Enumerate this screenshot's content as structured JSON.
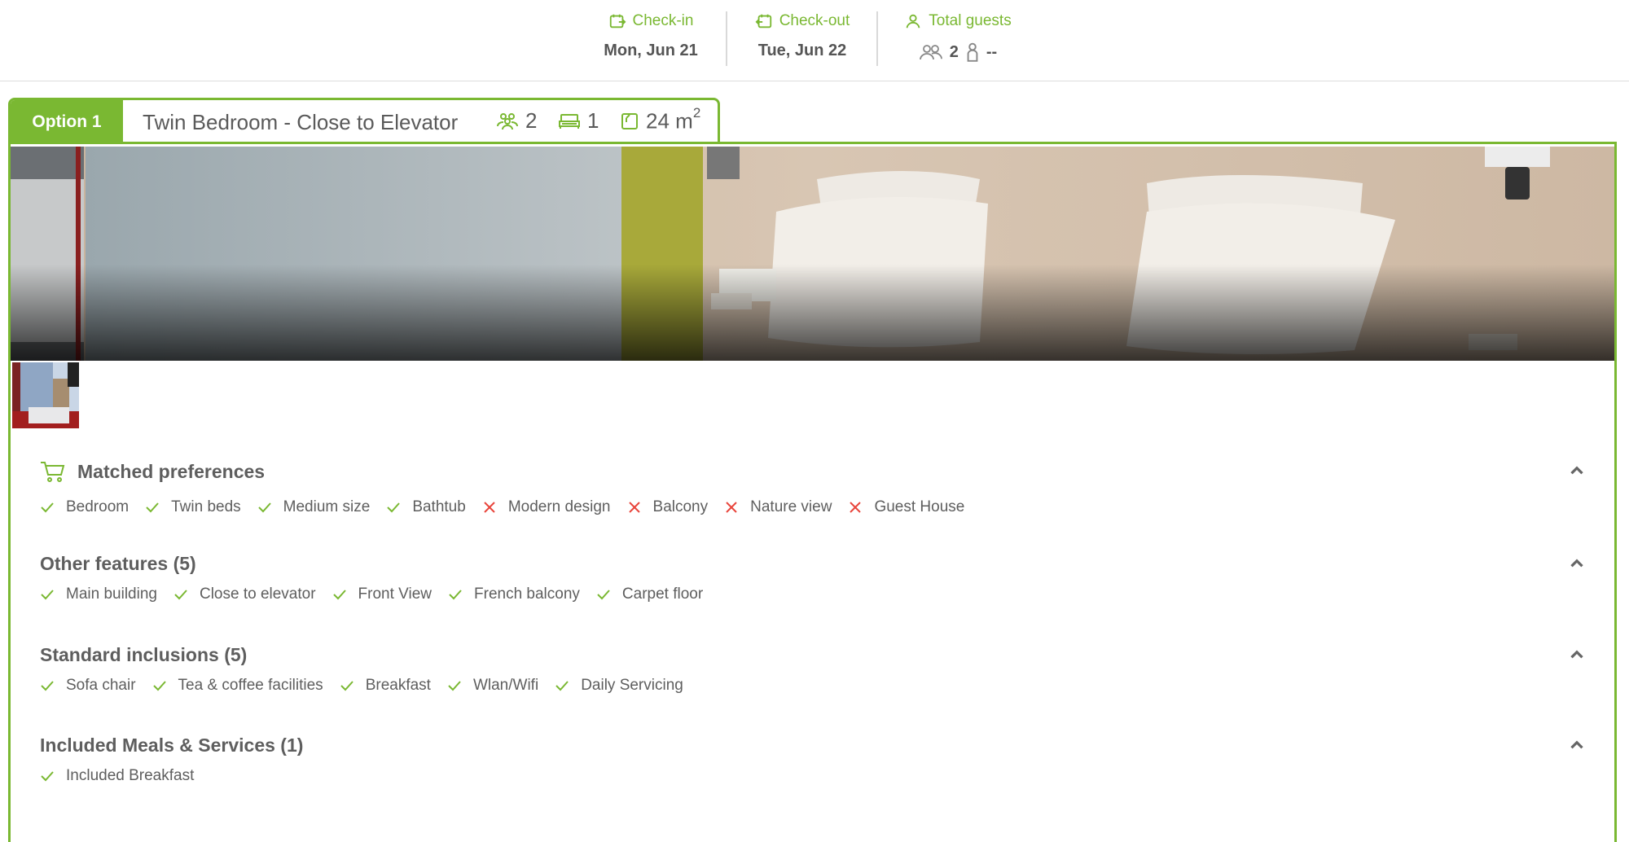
{
  "header": {
    "checkin_label": "Check-in",
    "checkin_value": "Mon, Jun 21",
    "checkout_label": "Check-out",
    "checkout_value": "Tue, Jun 22",
    "guests_label": "Total guests",
    "adults": "2",
    "children": "--"
  },
  "option": {
    "label": "Option 1",
    "title": "Twin Bedroom - Close to Elevator",
    "guests": "2",
    "beds": "1",
    "size": "24 m",
    "size_exp": "2"
  },
  "sections": [
    {
      "title": "Matched preferences",
      "items": [
        {
          "label": "Bedroom",
          "ok": true
        },
        {
          "label": "Twin beds",
          "ok": true
        },
        {
          "label": "Medium size",
          "ok": true
        },
        {
          "label": "Bathtub",
          "ok": true
        },
        {
          "label": "Modern design",
          "ok": false
        },
        {
          "label": "Balcony",
          "ok": false
        },
        {
          "label": "Nature view",
          "ok": false
        },
        {
          "label": "Guest House",
          "ok": false
        }
      ]
    },
    {
      "title": "Other features (5)",
      "items": [
        {
          "label": "Main building",
          "ok": true
        },
        {
          "label": "Close to elevator",
          "ok": true
        },
        {
          "label": "Front View",
          "ok": true
        },
        {
          "label": "French balcony",
          "ok": true
        },
        {
          "label": "Carpet floor",
          "ok": true
        }
      ]
    },
    {
      "title": "Standard inclusions (5)",
      "items": [
        {
          "label": "Sofa chair",
          "ok": true
        },
        {
          "label": "Tea & coffee facilities",
          "ok": true
        },
        {
          "label": "Breakfast",
          "ok": true
        },
        {
          "label": "Wlan/Wifi",
          "ok": true
        },
        {
          "label": "Daily Servicing",
          "ok": true
        }
      ]
    },
    {
      "title": "Included Meals & Services (1)",
      "items": [
        {
          "label": "Included Breakfast",
          "ok": true
        }
      ]
    }
  ],
  "colors": {
    "accent": "#7ab832",
    "negative": "#e8453c",
    "text": "#5e5e5e"
  },
  "icons": {
    "check": "check-icon",
    "cross": "cross-icon",
    "cart": "cart-icon",
    "chevron": "chevron-up-icon"
  }
}
